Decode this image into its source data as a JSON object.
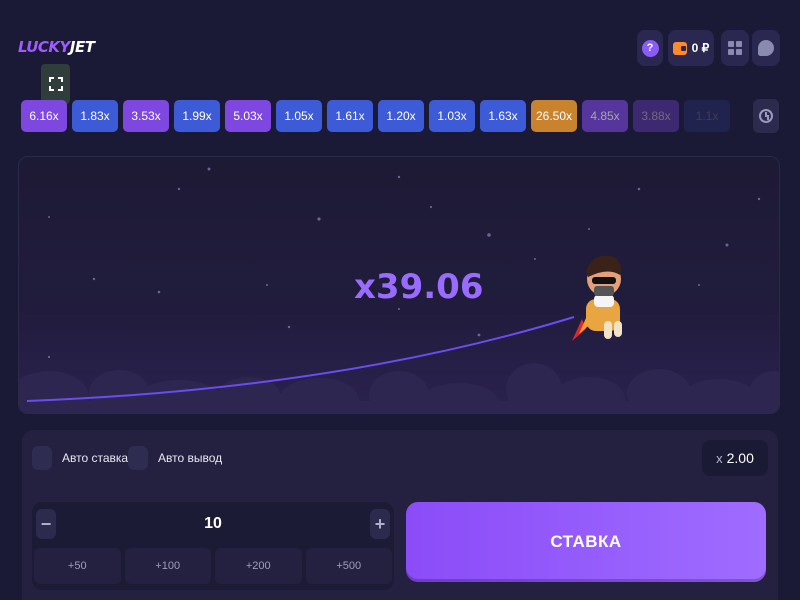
{
  "logo": {
    "lucky": "LUCKY",
    "jet": "JET"
  },
  "header": {
    "help_label": "?",
    "balance": "0 ₽"
  },
  "history": [
    {
      "value": "6.16x",
      "color": "#7e47e0",
      "alpha": 1
    },
    {
      "value": "1.83x",
      "color": "#3d5bd6",
      "alpha": 1
    },
    {
      "value": "3.53x",
      "color": "#7e47e0",
      "alpha": 1
    },
    {
      "value": "1.99x",
      "color": "#3d5bd6",
      "alpha": 1
    },
    {
      "value": "5.03x",
      "color": "#7e47e0",
      "alpha": 1
    },
    {
      "value": "1.05x",
      "color": "#3d5bd6",
      "alpha": 1
    },
    {
      "value": "1.61x",
      "color": "#3d5bd6",
      "alpha": 1
    },
    {
      "value": "1.20x",
      "color": "#3d5bd6",
      "alpha": 1
    },
    {
      "value": "1.03x",
      "color": "#3d5bd6",
      "alpha": 1
    },
    {
      "value": "1.63x",
      "color": "#3d5bd6",
      "alpha": 1
    },
    {
      "value": "26.50x",
      "color": "#c9832d",
      "alpha": 1
    },
    {
      "value": "4.85x",
      "color": "#7e47e0",
      "alpha": 0.6
    },
    {
      "value": "3.88x",
      "color": "#7e47e0",
      "alpha": 0.35
    },
    {
      "value": "1.1x",
      "color": "#3d5bd6",
      "alpha": 0.15
    }
  ],
  "game": {
    "multiplier": "x39.06"
  },
  "panel": {
    "auto_bet_label": "Авто ставка",
    "auto_cashout_label": "Авто вывод",
    "cashout_prefix": "x",
    "cashout_value": "2.00",
    "minus": "−",
    "plus": "+",
    "stake": "10",
    "quick_bets": [
      "+50",
      "+100",
      "+200",
      "+500"
    ],
    "bet_label": "СТАВКА"
  },
  "colors": {
    "accent": "#9a6bff",
    "background": "#1b1a36"
  }
}
